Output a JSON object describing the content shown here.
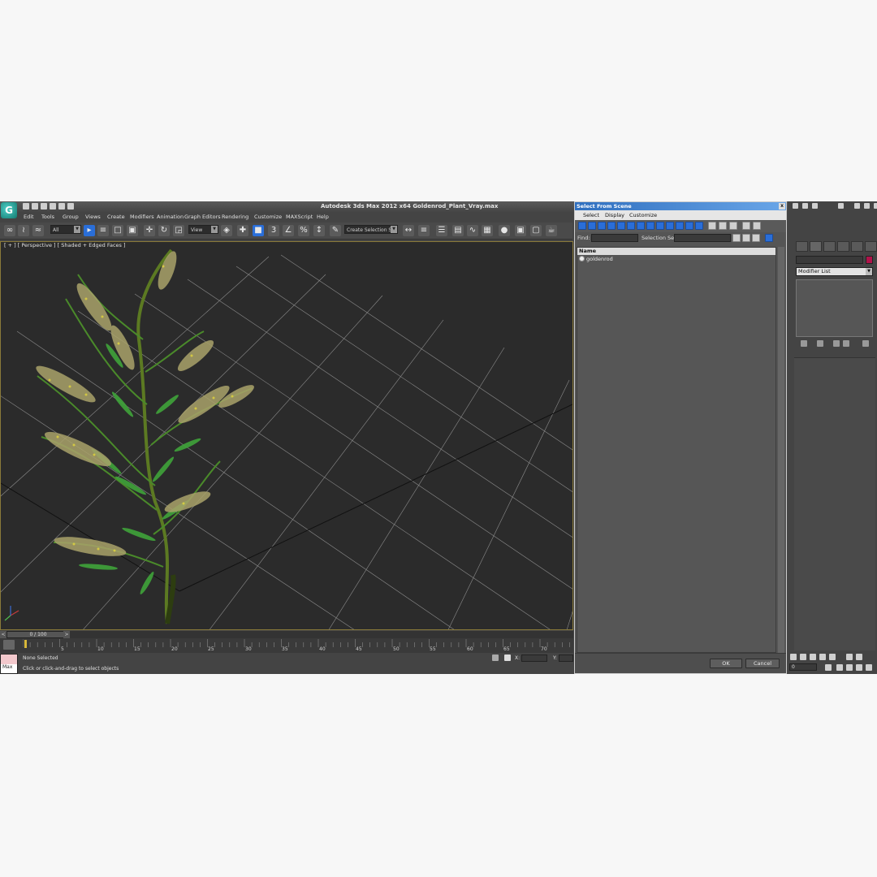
{
  "app": {
    "logo_glyph": "G",
    "title": "Autodesk 3ds Max  2012 x64     Goldenrod_Plant_Vray.max"
  },
  "menu": [
    "Edit",
    "Tools",
    "Group",
    "Views",
    "Create",
    "Modifiers",
    "Animation",
    "Graph Editors",
    "Rendering",
    "Customize",
    "MAXScript",
    "Help"
  ],
  "toolbar": {
    "filter_value": "All",
    "reference_coord": "View",
    "named_selection": "Create Selection Se"
  },
  "viewport": {
    "label": "[ + ] [ Perspective ] [ Shaded + Edged Faces ]"
  },
  "timeslider": {
    "frame_label": "0 / 100",
    "prev": "<",
    "next": ">"
  },
  "trackbar": {
    "ticks": [
      "5",
      "10",
      "15",
      "20",
      "25",
      "30",
      "35",
      "40",
      "45",
      "50",
      "55",
      "60",
      "65",
      "70"
    ]
  },
  "statusbar": {
    "maxscript_label": "Max",
    "selection_text": "None Selected",
    "prompt_text": "Click or click-and-drag to select objects",
    "x_label": "X:",
    "y_label": "Y:"
  },
  "dialog": {
    "title": "Select From Scene",
    "close_glyph": "x",
    "menu": [
      "Select",
      "Display",
      "Customize"
    ],
    "find_label": "Find:",
    "selection_set_label": "Selection Set:",
    "column_name": "Name",
    "items": [
      "goldenrod"
    ],
    "ok_label": "OK",
    "cancel_label": "Cancel"
  },
  "command_panel": {
    "modifier_list": "Modifier List",
    "color_swatch": "#b0134a",
    "time_value": "0"
  },
  "colors": {
    "accent": "#2a6ed8",
    "viewport_bg": "#2b2b2b",
    "grid": "#8c8c8c",
    "plant_leaf": "#3fa33a",
    "plant_flower": "#b0ad5a"
  }
}
